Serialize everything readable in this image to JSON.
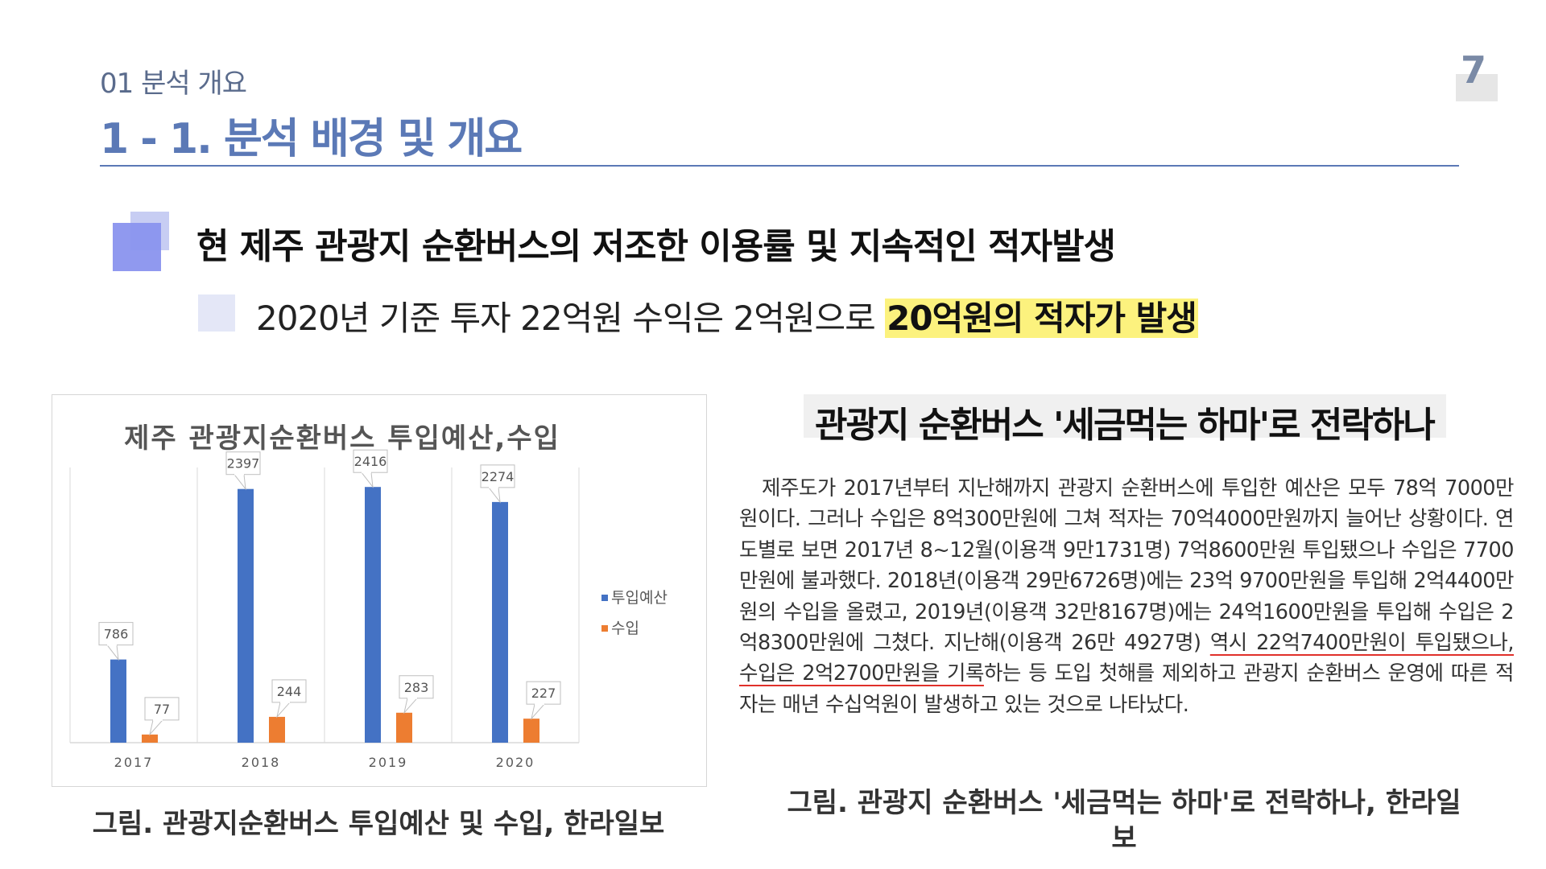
{
  "header": {
    "section_label": "01 분석 개요",
    "title": "1 - 1. 분석 배경 및 개요",
    "page_number": "7"
  },
  "headline": "현 제주 관광지 순환버스의 저조한 이용률 및 지속적인 적자발생",
  "subpoint": {
    "text": "2020년 기준 투자 22억원 수익은 2억원으로 ",
    "highlight": "20억원의 적자가 발생"
  },
  "chart_data": {
    "type": "bar",
    "title": "제주 관광지순환버스 투입예산,수입",
    "categories": [
      "2017",
      "2018",
      "2019",
      "2020"
    ],
    "series": [
      {
        "name": "투입예산",
        "color": "#4472c4",
        "values": [
          786,
          2397,
          2416,
          2274
        ]
      },
      {
        "name": "수입",
        "color": "#ed7d31",
        "values": [
          77,
          244,
          283,
          227
        ]
      }
    ],
    "ylim": [
      0,
      2600
    ],
    "grid": false,
    "legend": "right",
    "data_labels": true
  },
  "caption_left": "그림. 관광지순환버스 투입예산 및 수입, 한라일보",
  "news": {
    "title": "관광지 순환버스 '세금먹는 하마'로 전락하나",
    "body_before": "제주도가 2017년부터 지난해까지 관광지 순환버스에 투입한 예산은 모두 78억 7000만원이다. 그러나 수입은 8억300만원에 그쳐 적자는 70억4000만원까지 늘어난 상황이다. 연도별로 보면 2017년 8~12월(이용객 9만1731명) 7억8600만원 투입됐으나 수입은 7700만원에 불과했다. 2018년(이용객 29만6726명)에는 23억 9700만원을 투입해 2억4400만원의 수입을 올렸고, 2019년(이용객 32만8167명)에는 24억1600만원을 투입해 수입은 2억8300만원에 그쳤다. 지난해(이용객 26만 4927명) ",
    "body_underlined": "역시 22억7400만원이 투입됐으나, 수입은 2억2700만원을 기록",
    "body_after": "하는 등 도입 첫해를 제외하고 관광지 순환버스 운영에 따른 적자는 매년 수십억원이 발생하고 있는 것으로 나타났다."
  },
  "caption_right": "그림. 관광지 순환버스 '세금먹는 하마'로 전락하나, 한라일보"
}
